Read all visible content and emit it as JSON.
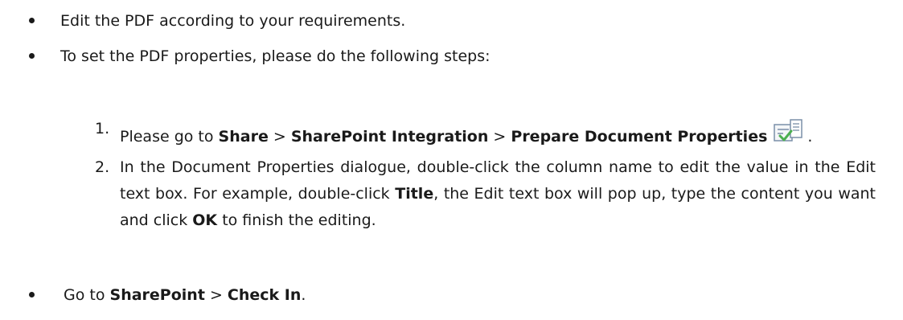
{
  "bullets": [
    {
      "text": "Edit the PDF according to your requirements."
    },
    {
      "text": "To set the PDF properties, please do the following steps:"
    }
  ],
  "steps": [
    {
      "number": "1.",
      "t1": "Please go to ",
      "b1": "Share",
      "t2": " > ",
      "b2": "SharePoint Integration",
      "t3": " > ",
      "b3": "Prepare Document Properties",
      "t4": ".",
      "icon": "document-properties-icon"
    },
    {
      "number": "2.",
      "t1": "In the Document Properties dialogue, double-click the column name to edit the value in the Edit text box. For example, double-click ",
      "b1": "Title",
      "t2": ", the Edit text box will pop up, type the content you want and click ",
      "b2": "OK",
      "t3": " to finish the editing."
    }
  ],
  "final_bullet": {
    "t1": "Go to ",
    "b1": "SharePoint",
    "t2": " > ",
    "b2": "Check In",
    "t3": "."
  },
  "colors": {
    "text": "#1a1a1a",
    "icon_accent": "#4caf50",
    "icon_frame": "#7a8fa8"
  }
}
